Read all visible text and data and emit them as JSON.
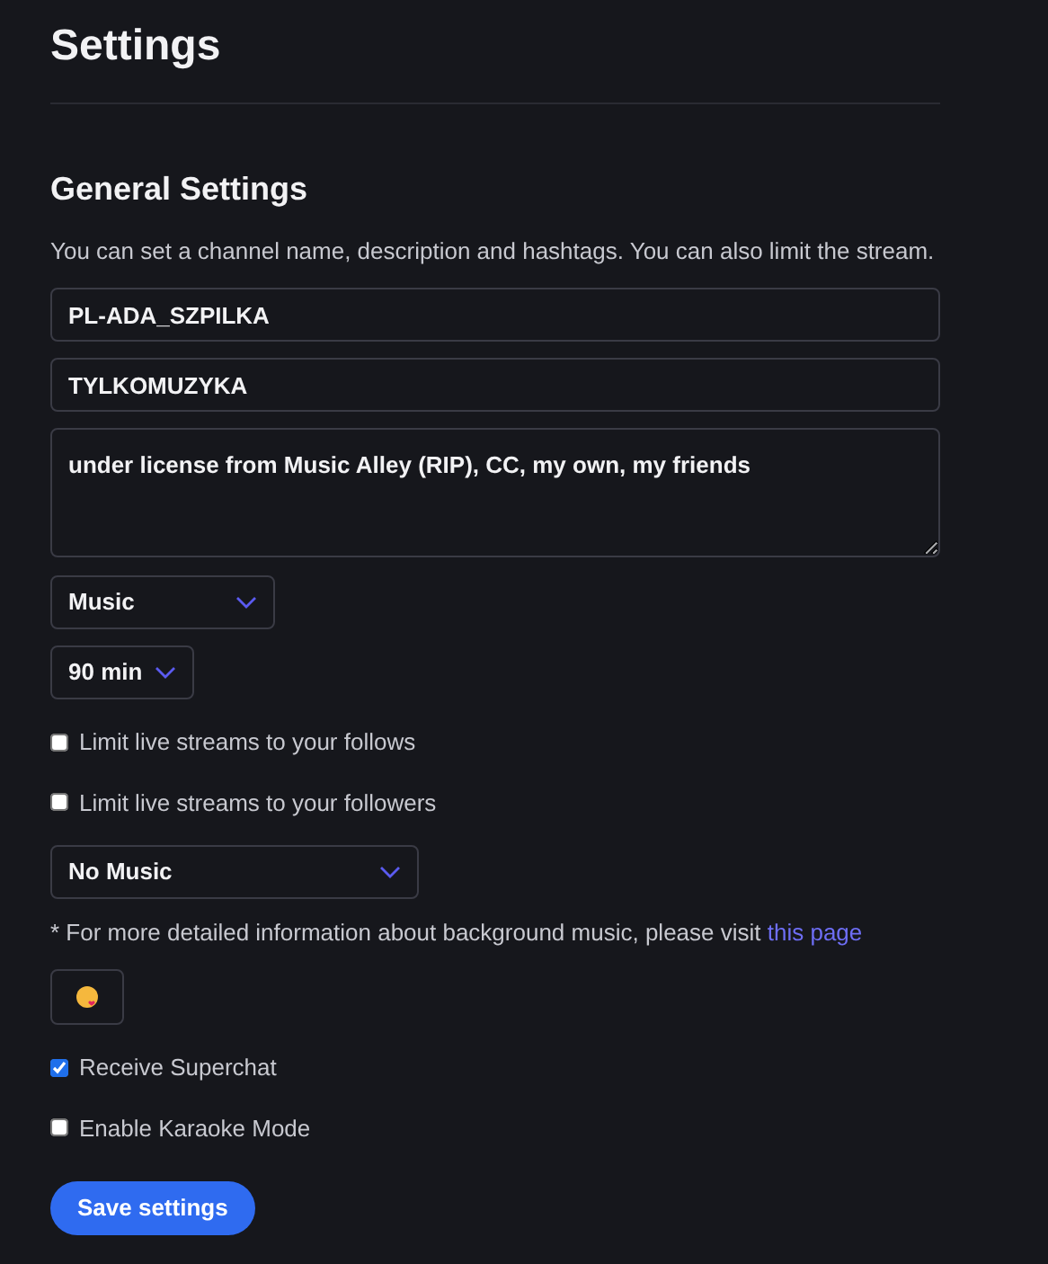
{
  "page_title": "Settings",
  "section_title": "General Settings",
  "intro": "You can set a channel name, description and hashtags. You can also limit the stream.",
  "fields": [
    {
      "kind": "input",
      "value": "PL-ADA_SZPILKA"
    },
    {
      "kind": "input",
      "value": "TYLKOMUZYKA"
    },
    {
      "kind": "textarea",
      "value": "under license from Music Alley (RIP), CC, my own, my friends"
    }
  ],
  "category": {
    "value": "Music"
  },
  "duration": {
    "value": "90 min"
  },
  "limits": [
    {
      "label": "Limit live streams to your follows",
      "checked": false
    },
    {
      "label": "Limit live streams to your followers",
      "checked": false
    }
  ],
  "music": {
    "value": "No Music"
  },
  "note": {
    "text": "* For more detailed information about background music, please visit",
    "link": "this page"
  },
  "toggles": [
    {
      "label": "Receive Superchat",
      "checked": true
    },
    {
      "label": "Enable Karaoke Mode",
      "checked": false
    }
  ],
  "save_button": "Save settings"
}
